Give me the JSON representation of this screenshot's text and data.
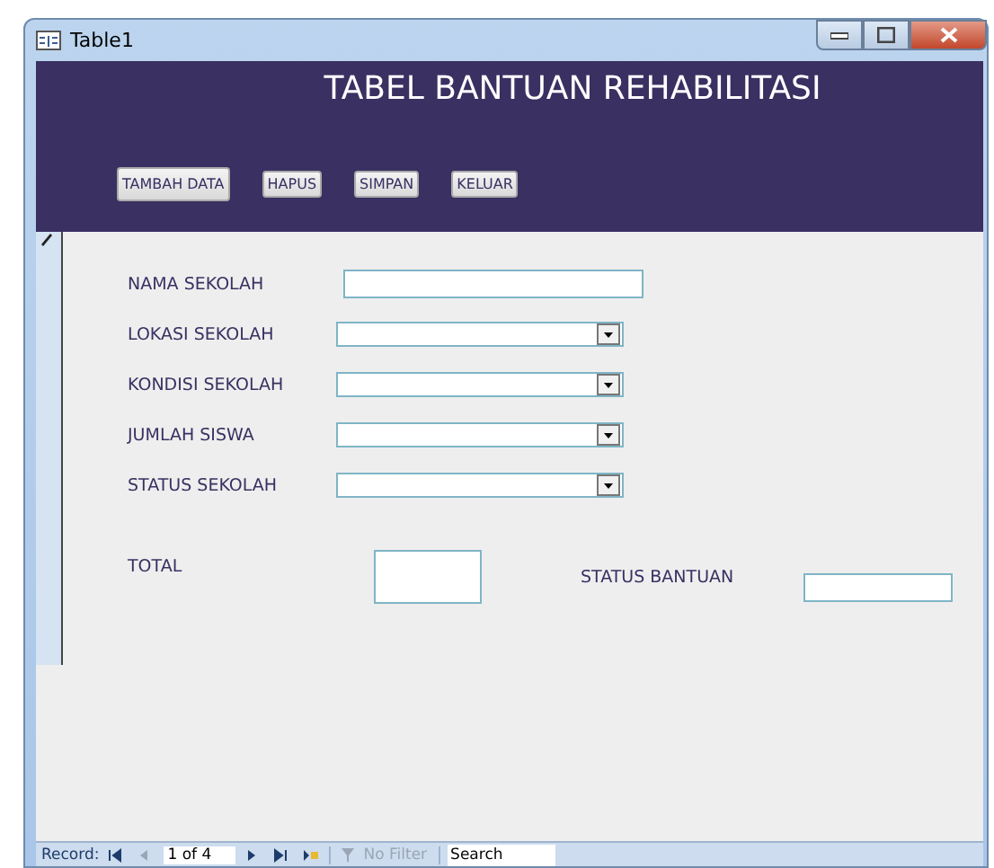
{
  "window": {
    "title": "Table1"
  },
  "header": {
    "title": "TABEL BANTUAN REHABILITASI"
  },
  "buttons": [
    "TAMBAH DATA",
    "HAPUS",
    "SIMPAN",
    "KELUAR"
  ],
  "fields": [
    {
      "label": "NAMA SEKOLAH",
      "kind": "text"
    },
    {
      "label": "LOKASI SEKOLAH",
      "kind": "combo"
    },
    {
      "label": "KONDISI SEKOLAH",
      "kind": "combo"
    },
    {
      "label": "JUMLAH SISWA",
      "kind": "combo"
    },
    {
      "label": "STATUS SEKOLAH",
      "kind": "combo"
    }
  ],
  "total": {
    "label": "TOTAL"
  },
  "status_bantuan": {
    "label": "STATUS BANTUAN"
  },
  "navigation": {
    "label": "Record:",
    "position": "1 of 4",
    "filter": {
      "label": "No Filter",
      "disabled": true
    },
    "search": {
      "placeholder": "Search"
    }
  }
}
